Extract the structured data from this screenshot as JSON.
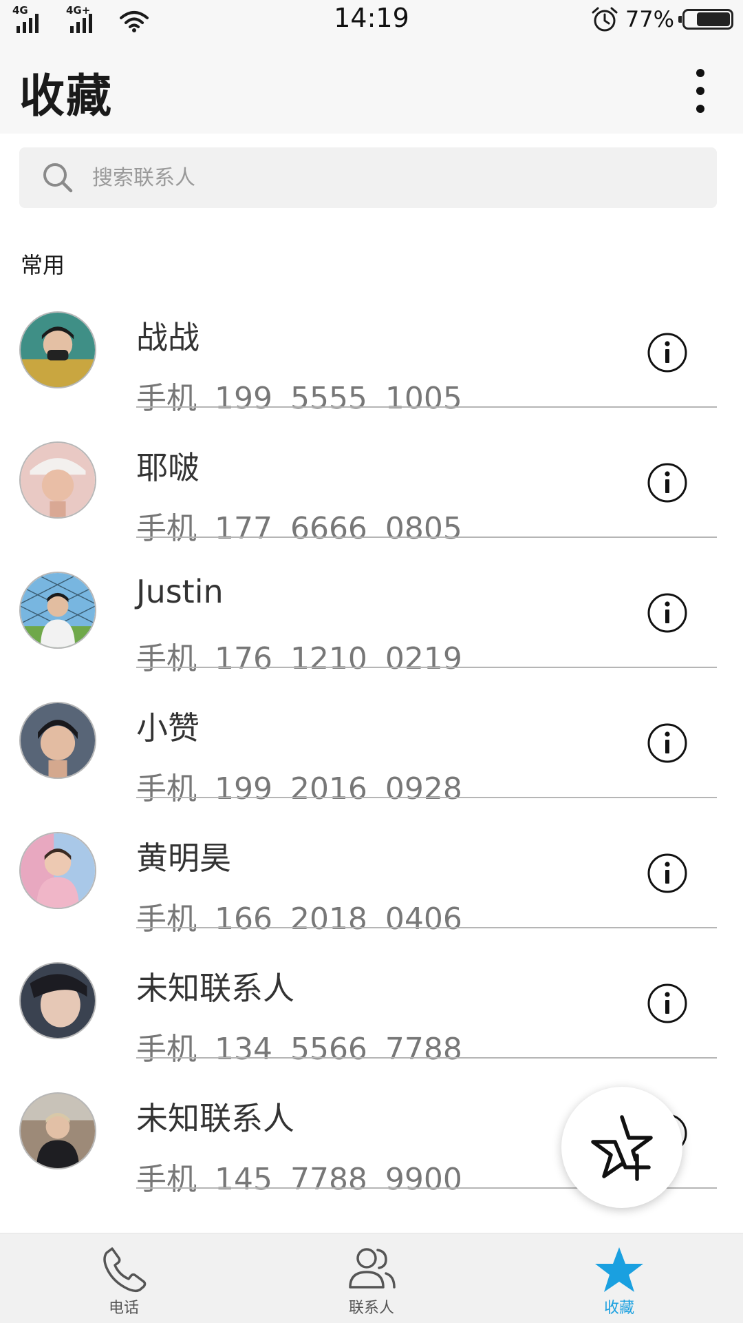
{
  "status_bar": {
    "network_1": "4G",
    "network_2": "4G+",
    "time": "14:19",
    "battery_percent": "77%",
    "battery_level": 0.77
  },
  "header": {
    "title": "收藏"
  },
  "search": {
    "placeholder": "搜索联系人"
  },
  "section": {
    "label": "常用"
  },
  "contacts": [
    {
      "name": "战战",
      "phone": "手机 199 5555 1005"
    },
    {
      "name": "耶啵",
      "phone": "手机 177 6666 0805"
    },
    {
      "name": "Justin",
      "phone": "手机 176 1210 0219"
    },
    {
      "name": "小赞",
      "phone": "手机 199 2016 0928"
    },
    {
      "name": "黄明昊",
      "phone": "手机 166 2018 0406"
    },
    {
      "name": "未知联系人",
      "phone": "手机 134 5566 7788"
    },
    {
      "name": "未知联系人",
      "phone": "手机 145 7788 9900"
    }
  ],
  "fab": {
    "icon": "star-add-icon"
  },
  "bottom_nav": {
    "items": [
      {
        "label": "电话",
        "icon": "phone-icon"
      },
      {
        "label": "联系人",
        "icon": "contacts-icon"
      },
      {
        "label": "收藏",
        "icon": "star-icon"
      }
    ],
    "active_index": 2
  },
  "colors": {
    "accent": "#1aa0e0",
    "header_bg": "#f7f7f7",
    "search_bg": "#f1f1f1",
    "nav_bg": "#f1f1f1",
    "phone_text": "#777777"
  }
}
